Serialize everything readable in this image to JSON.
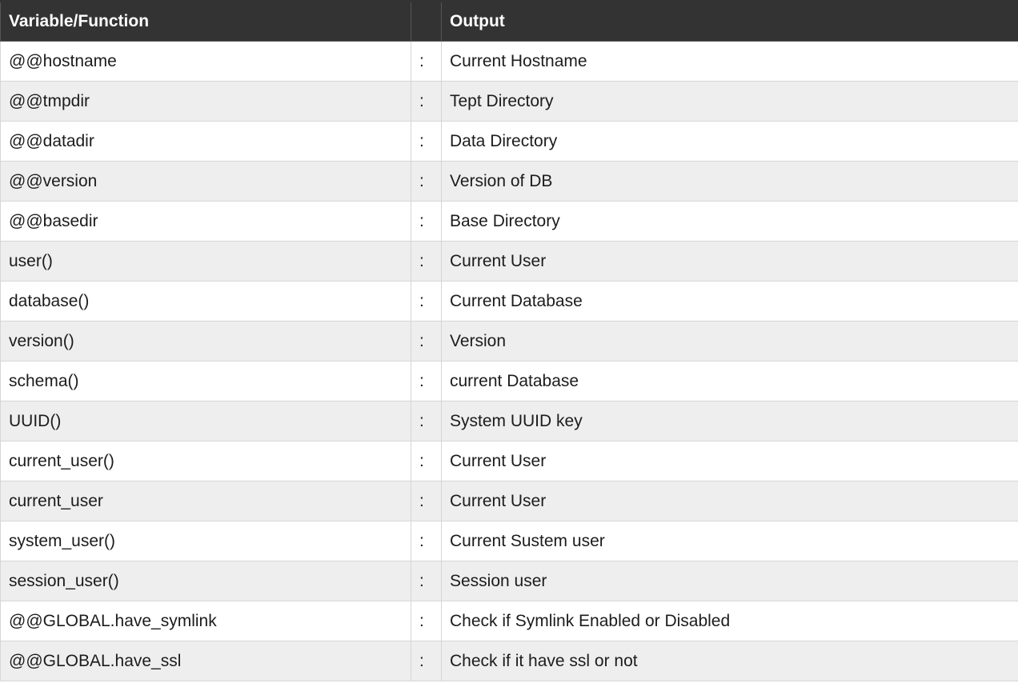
{
  "table": {
    "headers": [
      "Variable/Function",
      "",
      "Output"
    ],
    "rows": [
      {
        "variable": "@@hostname",
        "sep": ":",
        "output": "Current Hostname"
      },
      {
        "variable": "@@tmpdir",
        "sep": ":",
        "output": "Tept Directory"
      },
      {
        "variable": "@@datadir",
        "sep": ":",
        "output": "Data Directory"
      },
      {
        "variable": "@@version",
        "sep": ":",
        "output": "Version of DB"
      },
      {
        "variable": "@@basedir",
        "sep": ":",
        "output": "Base Directory"
      },
      {
        "variable": "user()",
        "sep": ":",
        "output": "Current User"
      },
      {
        "variable": "database()",
        "sep": ":",
        "output": "Current Database"
      },
      {
        "variable": "version()",
        "sep": ":",
        "output": "Version"
      },
      {
        "variable": "schema()",
        "sep": ":",
        "output": "current Database"
      },
      {
        "variable": "UUID()",
        "sep": ":",
        "output": "System UUID key"
      },
      {
        "variable": "current_user()",
        "sep": ":",
        "output": "Current User"
      },
      {
        "variable": "current_user",
        "sep": ":",
        "output": "Current User"
      },
      {
        "variable": "system_user()",
        "sep": ":",
        "output": "Current Sustem user"
      },
      {
        "variable": "session_user()",
        "sep": ":",
        "output": "Session user"
      },
      {
        "variable": "@@GLOBAL.have_symlink",
        "sep": ":",
        "output": "Check if Symlink Enabled or Disabled"
      },
      {
        "variable": "@@GLOBAL.have_ssl",
        "sep": ":",
        "output": "Check if it have ssl or not"
      }
    ]
  },
  "colors": {
    "header_bg": "#333333",
    "header_text": "#ffffff",
    "row_alt_bg": "#eeeeee",
    "border": "#d6d6d6"
  }
}
